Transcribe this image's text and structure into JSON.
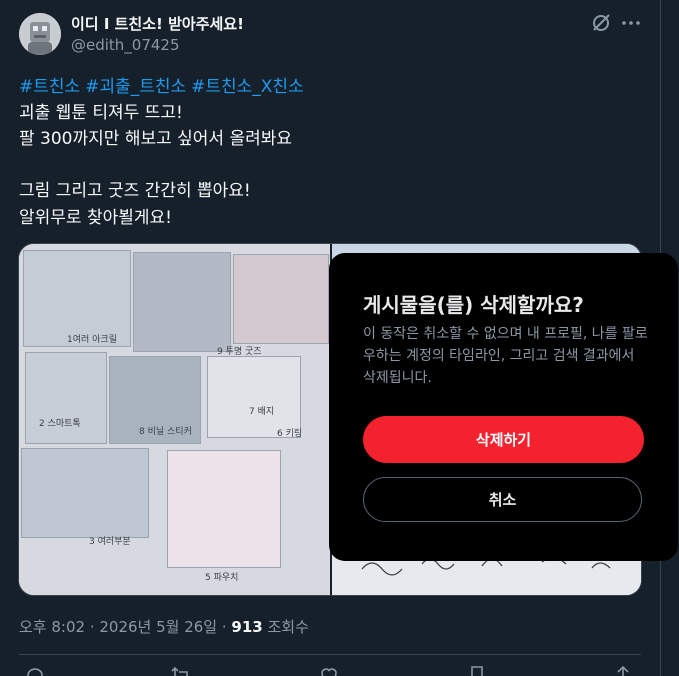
{
  "tweet": {
    "display_name": "이디 I 트친소! 받아주세요!",
    "handle": "@edith_07425",
    "hashtags": [
      "#트친소",
      "#괴출_트친소",
      "#트친소_X친소"
    ],
    "lines": [
      "괴출 웹툰 티져두 뜨고!",
      "팔 300까지만 해보고 싶어서 올려봐요",
      "",
      "그림 그리고 굿즈 간간히 뽑아요!",
      "알위무로 찾아뵐게요!"
    ],
    "time": "오후 8:02 · 2026년 5월 26일 · ",
    "views_count": "913",
    "views_label": " 조회수"
  },
  "dialog": {
    "title": "게시물을(를) 삭제할까요?",
    "body": "이 동작은 취소할 수 없으며 내 프로필, 나를 팔로우하는 계정의 타임라인, 그리고 검색 결과에서 삭제됩니다.",
    "delete_label": "삭제하기",
    "cancel_label": "취소"
  },
  "media_notes": [
    "1여러 아크릴",
    "9 투명 굿즈",
    "2 스마트톡",
    "8 비닐 스티커",
    "7 배지",
    "3 여러부분",
    "5 파우치",
    "6 키링"
  ],
  "icons": {
    "grok": "grok-icon",
    "more": "more-icon",
    "actions": [
      "reply-icon",
      "repost-icon",
      "like-icon",
      "bookmark-icon",
      "share-icon"
    ]
  },
  "colors": {
    "background": "#15202b",
    "hashtag": "#1d9bf0",
    "delete": "#f4212e",
    "dialog": "#000000"
  }
}
